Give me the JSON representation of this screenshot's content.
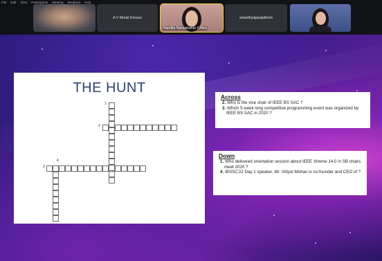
{
  "menu": {
    "items": [
      "File",
      "Edit",
      "View",
      "Participants",
      "Meeting",
      "Breakout",
      "Help"
    ]
  },
  "participants": [
    {
      "name": "",
      "camera": "on"
    },
    {
      "name": "A-V Munal Dsouza",
      "camera": "off"
    },
    {
      "name": "Nandita Nandakumar (Ofiss)",
      "camera": "on",
      "speaking": true
    },
    {
      "name": "amanthyagarajakhors",
      "camera": "off"
    },
    {
      "name": "",
      "camera": "on"
    }
  ],
  "puzzle": {
    "title": "THE HUNT",
    "clue_numbers": [
      "1",
      "2",
      "3",
      "4"
    ]
  },
  "clues": {
    "across": {
      "heading": "Across",
      "items": [
        {
          "num": "2.",
          "text": "Who is the vice chair of IEEE BS SAC ?"
        },
        {
          "num": "3.",
          "text": "Which 5 week long competitive programming event was organized by IEEE BS SAC in 2020 ?"
        }
      ]
    },
    "down": {
      "heading": "Down",
      "items": [
        {
          "num": "1.",
          "text": "Who delivered orientation session about IEEE Xtreme 14.0 in SB chairs meet 2020 ?"
        },
        {
          "num": "4.",
          "text": "IBSSC'22 Day 1 speaker, Mr. Vidyut Mohan is co-founder and CEO of ?"
        }
      ]
    }
  },
  "colors": {
    "title": "#2d466c",
    "speaking_border": "#f2d23e",
    "background_accent": "#e246dc"
  }
}
